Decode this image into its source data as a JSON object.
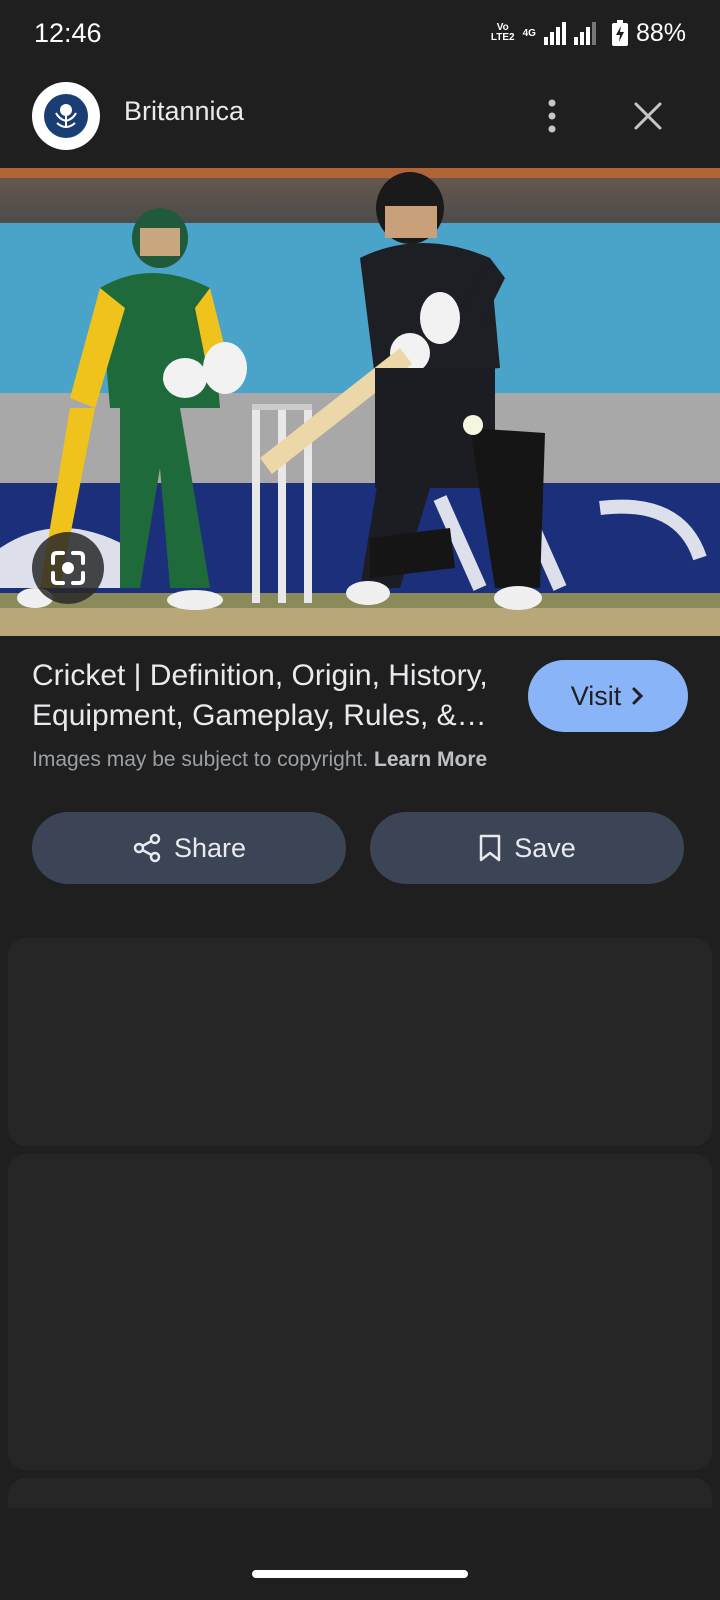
{
  "status_bar": {
    "time": "12:46",
    "network_top": "Vo",
    "network_bottom": "LTE2",
    "network_type": "4G",
    "battery_percent": "88%"
  },
  "header": {
    "source_name": "Britannica",
    "logo_icon": "britannica-thistle-logo",
    "more_icon": "more-vertical-icon",
    "close_icon": "close-icon"
  },
  "image": {
    "lens_icon": "google-lens-icon"
  },
  "result": {
    "title": "Cricket | Definition, Origin, History, Equipment, Gameplay, Rules, & Facts",
    "visit_label": "Visit",
    "copyright_text": "Images may be subject to copyright.",
    "learn_more_label": "Learn More"
  },
  "actions": {
    "share_label": "Share",
    "save_label": "Save"
  },
  "colors": {
    "background": "#1f1f1f",
    "visit_button": "#8ab4f8",
    "action_button": "#3b4556",
    "card": "#262626"
  }
}
